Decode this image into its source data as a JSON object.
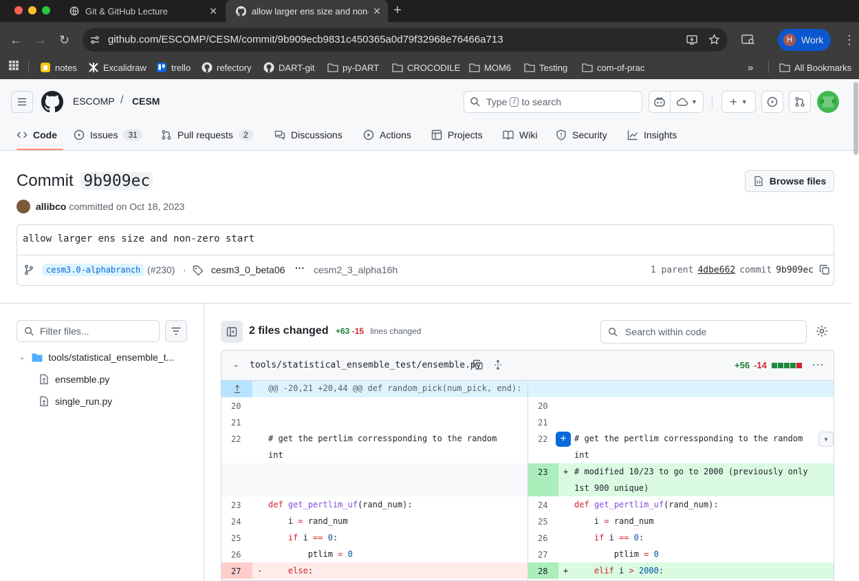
{
  "browser": {
    "tabs": [
      {
        "title": "Git & GitHub Lecture"
      },
      {
        "title": "allow larger ens size and non-"
      }
    ],
    "url": "github.com/ESCOMP/CESM/commit/9b909ecb9831c450365a0d79f32968e76466a713",
    "profile_initial": "H",
    "profile_label": "Work",
    "bookmarks": [
      "notes",
      "Excalidraw",
      "trello",
      "refectory",
      "DART-git",
      "py-DART",
      "CROCODILE",
      "MOM6",
      "Testing",
      "com-of-prac"
    ],
    "all_bookmarks": "All Bookmarks"
  },
  "header": {
    "owner": "ESCOMP",
    "separator": "/",
    "repo": "CESM",
    "search_prefix": "Type",
    "search_key": "/",
    "search_suffix": "to search"
  },
  "repo_tabs": [
    {
      "label": "Code"
    },
    {
      "label": "Issues",
      "count": "31"
    },
    {
      "label": "Pull requests",
      "count": "2"
    },
    {
      "label": "Discussions"
    },
    {
      "label": "Actions"
    },
    {
      "label": "Projects"
    },
    {
      "label": "Wiki"
    },
    {
      "label": "Security"
    },
    {
      "label": "Insights"
    }
  ],
  "commit": {
    "title": "Commit",
    "short_sha": "9b909ec",
    "browse_label": "Browse files",
    "author": "allibco",
    "committed": "committed on Oct 18, 2023",
    "message": "allow larger ens size and non-zero start",
    "branch": "cesm3.0-alphabranch",
    "pr": "(#230)",
    "dot": "·",
    "tag1": "cesm3_0_beta06",
    "ellipsis": "···",
    "tag2": "cesm2_3_alpha16h",
    "parent_label": "1 parent",
    "parent_sha": "4dbe662",
    "commit_label": "commit",
    "commit_sha": "9b909ec"
  },
  "sidebar": {
    "filter_placeholder": "Filter files...",
    "folder": "tools/statistical_ensemble_t...",
    "files": [
      "ensemble.py",
      "single_run.py"
    ]
  },
  "diff": {
    "files_changed": "2 files changed",
    "additions": "+63",
    "deletions": "-15",
    "lines_changed": "lines changed",
    "search_placeholder": "Search within code",
    "file": {
      "path": "tools/statistical_ensemble_test/ensemble.py",
      "additions": "+56",
      "deletions": "-14"
    },
    "hunk": "@@ -20,21 +20,44 @@ def random_pick(num_pick, end):",
    "rows": [
      {
        "l": "20",
        "r": "20",
        "lcode": "",
        "rcode": ""
      },
      {
        "l": "21",
        "r": "21",
        "lcode": "",
        "rcode": ""
      },
      {
        "l": "22",
        "r": "22",
        "lcode": "# get the pertlim corressponding to the random\nint",
        "rcode": "# get the pertlim corressponding to the random\nint"
      },
      {
        "l": "",
        "r": "23",
        "lcode": "",
        "rcode": "# modified 10/23 to go to 2000 (previously only\n1st 900 unique)"
      },
      {
        "l": "23",
        "r": "24",
        "lcode": "def get_pertlim_uf(rand_num):",
        "rcode": "def get_pertlim_uf(rand_num):"
      },
      {
        "l": "24",
        "r": "25",
        "lcode": "    i = rand_num",
        "rcode": "    i = rand_num"
      },
      {
        "l": "25",
        "r": "26",
        "lcode": "    if i == 0:",
        "rcode": "    if i == 0:"
      },
      {
        "l": "26",
        "r": "27",
        "lcode": "        ptlim = 0",
        "rcode": "        ptlim = 0"
      },
      {
        "l": "27",
        "r": "28",
        "lcode": "    else:",
        "rcode": "    elif i > 2000:"
      }
    ],
    "plus_sign": "+",
    "minus_sign": "-"
  }
}
